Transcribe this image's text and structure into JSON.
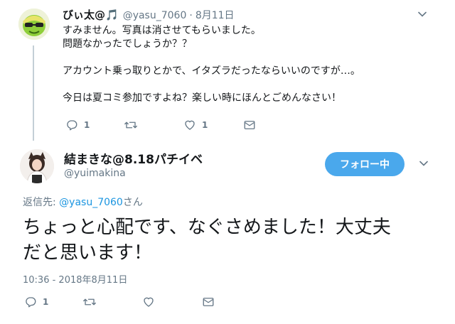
{
  "tweet1": {
    "display_name": "びぃ太@🎵",
    "handle": "@yasu_7060",
    "separator": "·",
    "date": "8月11日",
    "lines": [
      "すみません。写真は消させてもらいました。",
      "問題なかったでしょうか？？",
      "",
      "アカウント乗っ取りとかで、イタズラだったならいいのですが…。",
      "",
      "今日は夏コミ参加ですよね？楽しい時にほんとごめんなさい！"
    ],
    "reply_count": "1",
    "retweet_count": "",
    "like_count": "1"
  },
  "tweet2": {
    "display_name": "結まきな@8.18パチイベ",
    "handle": "@yuimakina",
    "follow_label": "フォロー中",
    "reply_prefix": "返信先: ",
    "reply_mention": "@yasu_7060",
    "reply_suffix": "さん",
    "text_lines": [
      "ちょっと心配です、なぐさめました！大丈夫",
      "だと思います！"
    ],
    "timestamp": "10:36 - 2018年8月11日",
    "reply_count": "1",
    "retweet_count": "",
    "like_count": ""
  },
  "colors": {
    "accent": "#4aa8ec",
    "link": "#1b95e0",
    "muted": "#657786",
    "thread_line": "#c4cfd6"
  },
  "icons": [
    "avatar-green-character",
    "avatar-user-photo",
    "chevron-down-icon",
    "reply-icon",
    "retweet-icon",
    "heart-icon",
    "mail-icon"
  ]
}
